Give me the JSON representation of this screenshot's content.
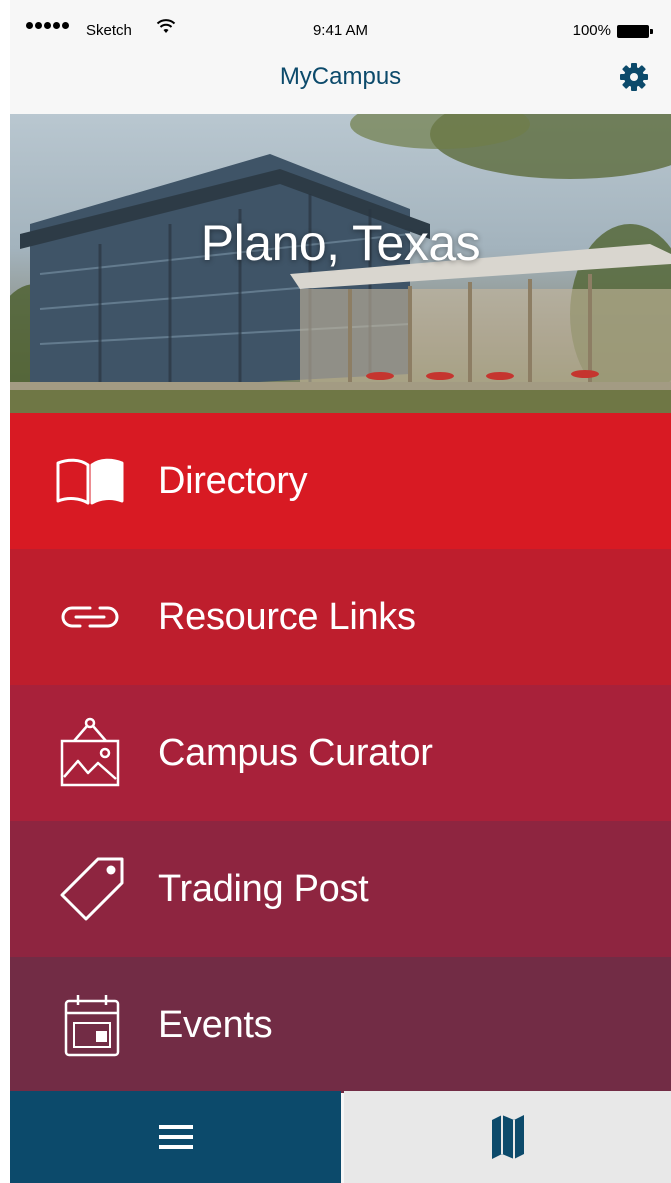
{
  "status_bar": {
    "carrier": "Sketch",
    "time": "9:41 AM",
    "battery": "100%"
  },
  "nav": {
    "title": "MyCampus",
    "settings_icon": "gear-icon"
  },
  "hero": {
    "location": "Plano, Texas"
  },
  "menu": {
    "items": [
      {
        "label": "Directory",
        "icon": "book-icon",
        "color": "#d81a23"
      },
      {
        "label": "Resource Links",
        "icon": "link-icon",
        "color": "#be1e2d"
      },
      {
        "label": "Campus Curator",
        "icon": "picture-frame-icon",
        "color": "#a8213a"
      },
      {
        "label": "Trading Post",
        "icon": "tag-icon",
        "color": "#8e2540"
      },
      {
        "label": "Events",
        "icon": "calendar-icon",
        "color": "#722c45"
      }
    ]
  },
  "tab_bar": {
    "tabs": [
      {
        "icon": "menu-icon",
        "active": true,
        "color": "#0c4a6b"
      },
      {
        "icon": "map-icon",
        "active": false,
        "color": "#e8e8e8"
      }
    ]
  }
}
